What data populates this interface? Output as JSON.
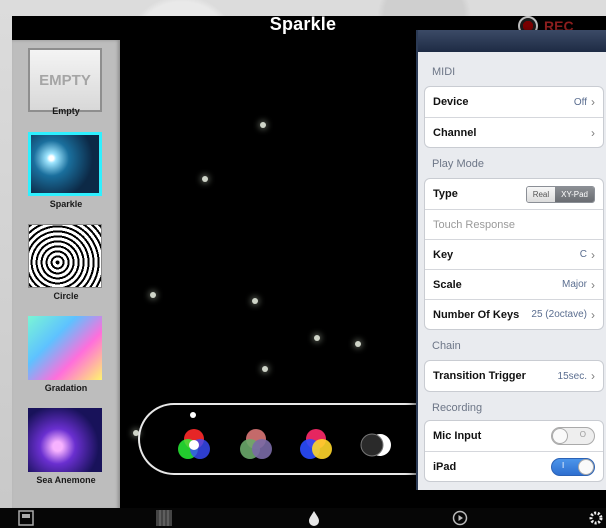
{
  "app": {
    "title": "Sparkle",
    "rec_label": "REC"
  },
  "sidebar": {
    "items": [
      {
        "label": "Empty",
        "thumb_text": "EMPTY",
        "selected": false
      },
      {
        "label": "Sparkle",
        "selected": true
      },
      {
        "label": "Circle",
        "selected": false
      },
      {
        "label": "Gradation",
        "selected": false
      },
      {
        "label": "Sea Anemone",
        "selected": false
      }
    ]
  },
  "palette": {
    "selected_index": 0,
    "swatch_icons": [
      "rgb-additive-icon",
      "muted-color-icon",
      "rgb-subtractive-icon",
      "black-white-icon"
    ]
  },
  "settings": {
    "midi": {
      "section": "MIDI",
      "device_label": "Device",
      "device_value": "Off",
      "channel_label": "Channel"
    },
    "play_mode": {
      "section": "Play Mode",
      "type_label": "Type",
      "type_options": [
        "Real",
        "XY-Pad"
      ],
      "type_selected": "XY-Pad",
      "touch_response_label": "Touch Response",
      "key_label": "Key",
      "key_value": "C",
      "scale_label": "Scale",
      "scale_value": "Major",
      "num_keys_label": "Number Of Keys",
      "num_keys_value": "25 (2octave)"
    },
    "chain": {
      "section": "Chain",
      "trigger_label": "Transition Trigger",
      "trigger_value": "15sec."
    },
    "recording": {
      "section": "Recording",
      "mic_label": "Mic Input",
      "mic_state": "O",
      "mic_on": false,
      "ipad_label": "iPad",
      "ipad_state": "I",
      "ipad_on": true
    }
  },
  "bottombar": {
    "icons": [
      "presets-icon",
      "grid-icon",
      "color-drop-icon",
      "play-icon",
      "gear-icon"
    ]
  }
}
